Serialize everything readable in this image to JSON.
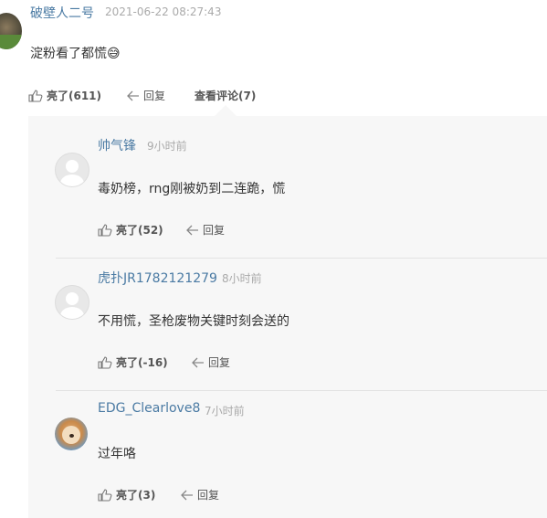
{
  "main_comment": {
    "username": "破壁人二号",
    "time": "2021-06-22 08:27:43",
    "text": "淀粉看了都慌😅",
    "like_label": "亮了(611)",
    "reply_label": "回复",
    "view_replies_label": "查看评论(7)"
  },
  "replies": [
    {
      "username": "帅气锋",
      "time": "9小时前",
      "text": "毒奶榜，rng刚被奶到二连跪，慌",
      "like_label": "亮了(52)",
      "reply_label": "回复",
      "avatar": "default-user"
    },
    {
      "username": "虎扑JR1782121279",
      "time": "8小时前",
      "text": "不用慌，圣枪废物关键时刻会送的",
      "like_label": "亮了(-16)",
      "reply_label": "回复",
      "avatar": "default-user"
    },
    {
      "username": "EDG_Clearlove8",
      "time": "7小时前",
      "text": "过年咯",
      "like_label": "亮了(3)",
      "reply_label": "回复",
      "avatar": "dog-photo"
    }
  ],
  "icons": {
    "like": "thumbs-up-icon",
    "reply": "reply-arrow-icon"
  },
  "colors": {
    "username": "#4a7aa3",
    "time": "#aaaaaa",
    "panel_bg": "#f7f7f7",
    "text": "#333333"
  }
}
